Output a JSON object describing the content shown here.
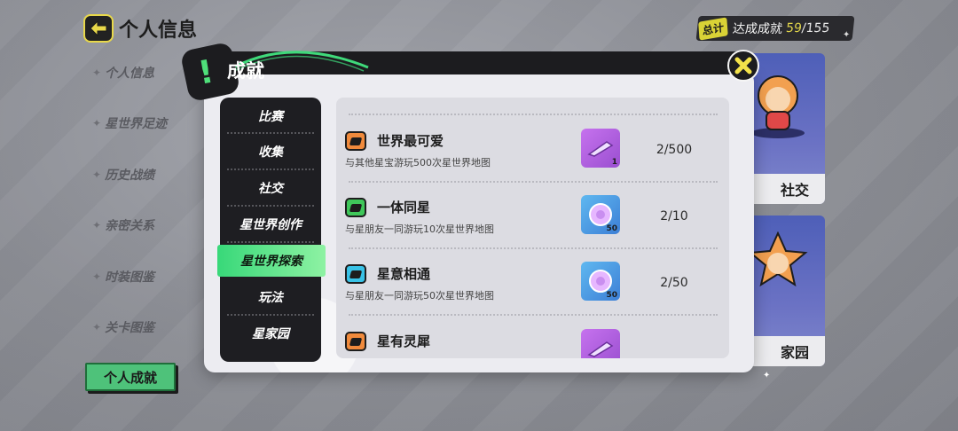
{
  "header": {
    "title": "个人信息",
    "summary_tag": "总计",
    "summary_label": "达成成就",
    "achieved": "59",
    "separator": "/",
    "total": "155"
  },
  "leftnav": {
    "items": [
      {
        "label": "个人信息"
      },
      {
        "label": "星世界足迹"
      },
      {
        "label": "历史战绩"
      },
      {
        "label": "亲密关系"
      },
      {
        "label": "时装图鉴"
      },
      {
        "label": "关卡图鉴"
      }
    ],
    "active_label": "个人成就"
  },
  "bg_cards": [
    {
      "label": "社交"
    },
    {
      "label": "家园"
    }
  ],
  "modal": {
    "title": "成就",
    "tabs": [
      {
        "label": "比赛"
      },
      {
        "label": "收集"
      },
      {
        "label": "社交"
      },
      {
        "label": "星世界创作"
      },
      {
        "label": "星世界探索"
      },
      {
        "label": "玩法"
      },
      {
        "label": "星家园"
      }
    ],
    "active_tab": "星世界探索",
    "achievements": [
      {
        "title": "世界最可爱",
        "desc": "与其他星宝游玩500次星世界地图",
        "reward_count": "1",
        "progress": "2/500",
        "badge_color": "#f08a3c",
        "reward_color": "#b35ad8"
      },
      {
        "title": "一体同星",
        "desc": "与星朋友一同游玩10次星世界地图",
        "reward_count": "50",
        "progress": "2/10",
        "badge_color": "#3fc75a",
        "reward_color": "#4ba0e8"
      },
      {
        "title": "星意相通",
        "desc": "与星朋友一同游玩50次星世界地图",
        "reward_count": "50",
        "progress": "2/50",
        "badge_color": "#39c2e6",
        "reward_color": "#4ba0e8"
      },
      {
        "title": "星有灵犀",
        "desc": "",
        "reward_count": "",
        "progress": "",
        "badge_color": "#f08a3c",
        "reward_color": "#b35ad8"
      }
    ]
  },
  "icons": {
    "back": "back-arrow-icon",
    "close": "close-x-icon",
    "accent": "#3fd97a",
    "close_color": "#f3e24a"
  }
}
